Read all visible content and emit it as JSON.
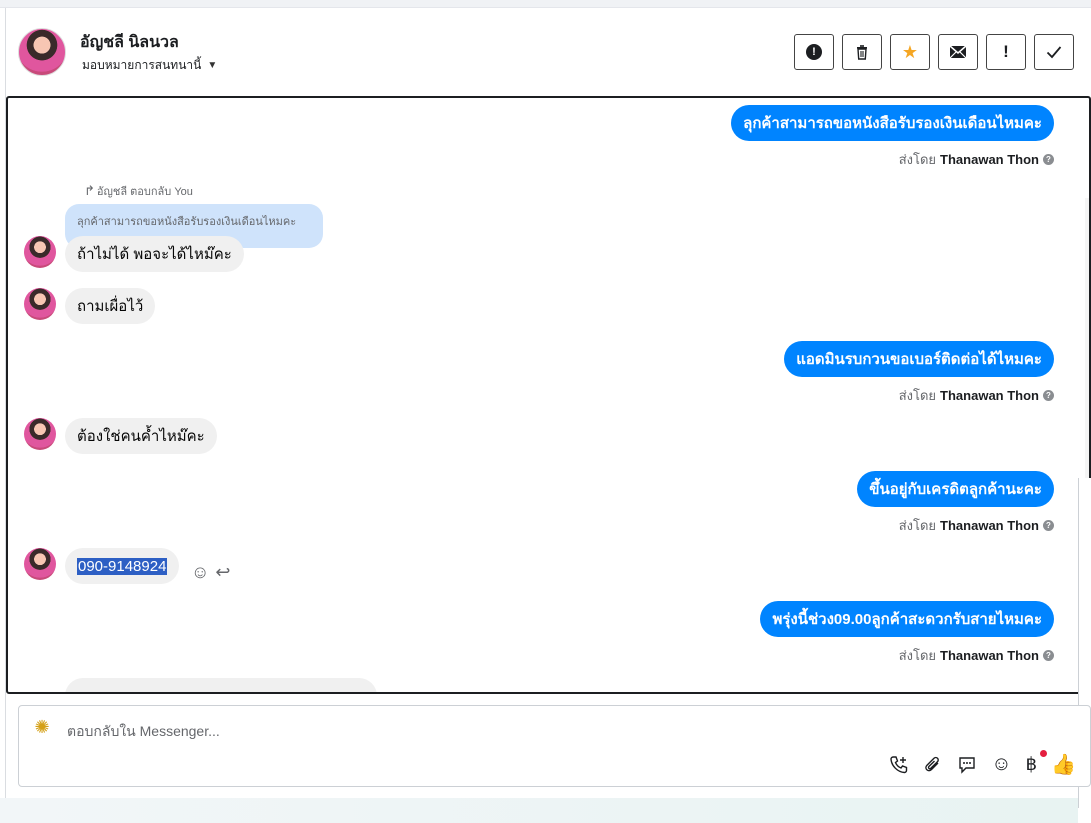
{
  "header": {
    "name": "อัญชลี นิลนวล",
    "assign_label": "มอบหมายการสนทนานี้",
    "actions": [
      {
        "icon": "alert-circle-icon"
      },
      {
        "icon": "trash-icon"
      },
      {
        "icon": "star-icon",
        "color": "#f5a623"
      },
      {
        "icon": "envelope-icon"
      },
      {
        "icon": "exclamation-icon"
      },
      {
        "icon": "check-icon"
      }
    ]
  },
  "thread": {
    "sent_by_prefix": "ส่งโดย",
    "agent_name": "Thanawan Thon",
    "reply_note": "อัญชลี ตอบกลับ You",
    "quoted_text": "ลุกค้าสามารถขอหนังสือรับรองเงินเดือนไหมคะ",
    "messages": [
      {
        "dir": "out",
        "text": "ลุกค้าสามารถขอหนังสือรับรองเงินเดือนไหมคะ"
      },
      {
        "dir": "in",
        "text": "ถ้าไม่ได้ พอจะได้ไหม๊คะ"
      },
      {
        "dir": "in",
        "text": "ถามเผื่อไว้"
      },
      {
        "dir": "out",
        "text": "แอดมินรบกวนขอเบอร์ติดต่อได้ไหมคะ"
      },
      {
        "dir": "in",
        "text": "ต้องใช่คนค้ำไหม๊คะ"
      },
      {
        "dir": "out",
        "text": "ขึ้นอยู่กับเครดิตลูกค้านะคะ"
      },
      {
        "dir": "in",
        "text": "090-9148924"
      },
      {
        "dir": "out",
        "text": "พรุ่งนี้ช่วง09.00ลูกค้าสะดวกรับสายไหมคะ"
      }
    ],
    "out_color": "#0084ff",
    "in_color": "#f0f0f0"
  },
  "composer": {
    "placeholder": "ตอบกลับใน Messenger...",
    "tools": [
      "phone-plus-icon",
      "paperclip-icon",
      "chat-bubble-icon",
      "smiley-icon",
      "baht-icon",
      "thumbs-up-icon"
    ]
  }
}
